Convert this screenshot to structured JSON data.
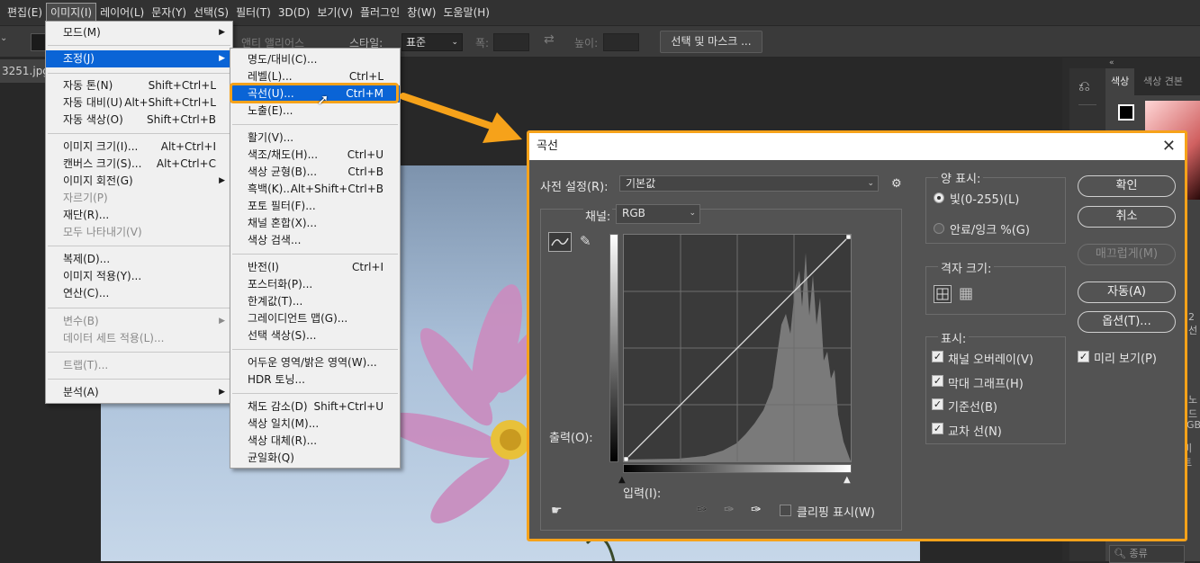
{
  "menubar": {
    "items": [
      "편집(E)",
      "이미지(I)",
      "레이어(L)",
      "문자(Y)",
      "선택(S)",
      "필터(T)",
      "3D(D)",
      "보기(V)",
      "플러그인",
      "창(W)",
      "도움말(H)"
    ]
  },
  "options_bar": {
    "antialias": "앤티 앨리어스",
    "style_label": "스타일:",
    "style_value": "표준",
    "width_label": "폭:",
    "height_label": "높이:",
    "select_mask_button": "선택 및 마스크 ..."
  },
  "document_tab": "3251.jpg (",
  "right_panel": {
    "tab_color": "색상",
    "tab_swatches": "색상 견본",
    "search_placeholder": "종류",
    "side_fragments": [
      "2 선",
      "GB",
      "비트",
      "노드"
    ]
  },
  "image_menu": {
    "items": [
      {
        "label": "모드(M)",
        "submenu": true
      },
      {
        "label": "조정(J)",
        "submenu": true,
        "highlighted": true
      },
      {
        "label": "자동 톤(N)",
        "shortcut": "Shift+Ctrl+L"
      },
      {
        "label": "자동 대비(U)",
        "shortcut": "Alt+Shift+Ctrl+L"
      },
      {
        "label": "자동 색상(O)",
        "shortcut": "Shift+Ctrl+B"
      },
      {
        "label": "이미지 크기(I)...",
        "shortcut": "Alt+Ctrl+I"
      },
      {
        "label": "캔버스 크기(S)...",
        "shortcut": "Alt+Ctrl+C"
      },
      {
        "label": "이미지 회전(G)",
        "submenu": true
      },
      {
        "label": "자르기(P)",
        "disabled": true
      },
      {
        "label": "재단(R)..."
      },
      {
        "label": "모두 나타내기(V)",
        "disabled": true
      },
      {
        "label": "복제(D)..."
      },
      {
        "label": "이미지 적용(Y)..."
      },
      {
        "label": "연산(C)..."
      },
      {
        "label": "변수(B)",
        "submenu": true,
        "disabled": true
      },
      {
        "label": "데이터 세트 적용(L)...",
        "disabled": true
      },
      {
        "label": "트랩(T)...",
        "disabled": true
      },
      {
        "label": "분석(A)",
        "submenu": true
      }
    ]
  },
  "adjust_menu": {
    "items": [
      {
        "label": "명도/대비(C)..."
      },
      {
        "label": "레벨(L)...",
        "shortcut": "Ctrl+L"
      },
      {
        "label": "곡선(U)...",
        "shortcut": "Ctrl+M",
        "highlighted": true
      },
      {
        "label": "노출(E)..."
      },
      {
        "label": "활기(V)..."
      },
      {
        "label": "색조/채도(H)...",
        "shortcut": "Ctrl+U"
      },
      {
        "label": "색상 균형(B)...",
        "shortcut": "Ctrl+B"
      },
      {
        "label": "흑백(K)...",
        "shortcut": "Alt+Shift+Ctrl+B"
      },
      {
        "label": "포토 필터(F)..."
      },
      {
        "label": "채널 혼합(X)..."
      },
      {
        "label": "색상 검색..."
      },
      {
        "label": "반전(I)",
        "shortcut": "Ctrl+I"
      },
      {
        "label": "포스터화(P)..."
      },
      {
        "label": "한계값(T)..."
      },
      {
        "label": "그레이디언트 맵(G)..."
      },
      {
        "label": "선택 색상(S)..."
      },
      {
        "label": "어두운 영역/밝은 영역(W)..."
      },
      {
        "label": "HDR 토닝..."
      },
      {
        "label": "채도 감소(D)",
        "shortcut": "Shift+Ctrl+U"
      },
      {
        "label": "색상 일치(M)..."
      },
      {
        "label": "색상 대체(R)..."
      },
      {
        "label": "균일화(Q)"
      }
    ]
  },
  "curves_dialog": {
    "title": "곡선",
    "preset_label": "사전 설정(R):",
    "preset_value": "기본값",
    "channel_label": "채널:",
    "channel_value": "RGB",
    "output_label": "출력(O):",
    "input_label": "입력(I):",
    "clipping_label": "클리핑 표시(W)",
    "clipping_checked": false,
    "amount_group": "양 표시:",
    "radio_light": "빛(0-255)(L)",
    "radio_pigment": "안료/잉크 %(G)",
    "radio_light_selected": true,
    "grid_group": "격자 크기:",
    "show_group": "표시:",
    "checks": [
      {
        "label": "채널 오버레이(V)",
        "checked": true
      },
      {
        "label": "막대 그래프(H)",
        "checked": true
      },
      {
        "label": "기준선(B)",
        "checked": true
      },
      {
        "label": "교차 선(N)",
        "checked": true
      }
    ],
    "buttons": {
      "ok": "확인",
      "cancel": "취소",
      "smooth": "매끄럽게(M)",
      "auto": "자동(A)",
      "options": "옵션(T)..."
    },
    "preview_label": "미리 보기(P)",
    "preview_checked": true
  },
  "colors": {
    "accent": "#f6a21a",
    "menu_highlight": "#0a64d6",
    "dialog_bg": "#535353"
  }
}
